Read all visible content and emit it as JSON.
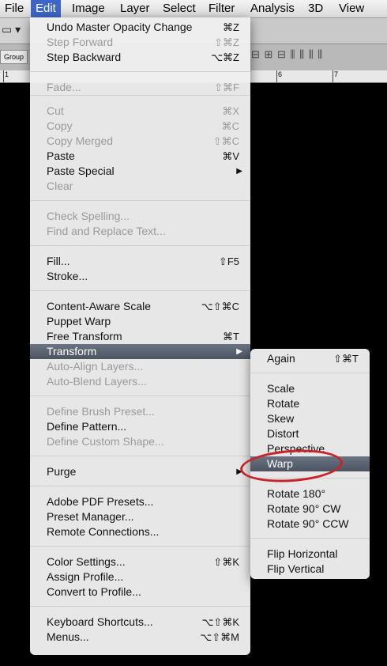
{
  "menubar": [
    "File",
    "Edit",
    "Image",
    "Layer",
    "Select",
    "Filter",
    "Analysis",
    "3D",
    "View"
  ],
  "options": {
    "group_label": "Group"
  },
  "ruler": [
    "1",
    "6",
    "7"
  ],
  "edit_menu": [
    {
      "label": "Undo Master Opacity Change",
      "shortcut": "⌘Z",
      "enabled": true
    },
    {
      "label": "Step Forward",
      "shortcut": "⇧⌘Z",
      "enabled": false
    },
    {
      "label": "Step Backward",
      "shortcut": "⌥⌘Z",
      "enabled": true
    },
    {
      "label": "Fade...",
      "shortcut": "⇧⌘F",
      "enabled": false
    },
    {
      "label": "Cut",
      "shortcut": "⌘X",
      "enabled": false
    },
    {
      "label": "Copy",
      "shortcut": "⌘C",
      "enabled": false
    },
    {
      "label": "Copy Merged",
      "shortcut": "⇧⌘C",
      "enabled": false
    },
    {
      "label": "Paste",
      "shortcut": "⌘V",
      "enabled": true
    },
    {
      "label": "Paste Special",
      "shortcut": "▶",
      "enabled": true
    },
    {
      "label": "Clear",
      "shortcut": "",
      "enabled": false
    },
    {
      "label": "Check Spelling...",
      "shortcut": "",
      "enabled": false
    },
    {
      "label": "Find and Replace Text...",
      "shortcut": "",
      "enabled": false
    },
    {
      "label": "Fill...",
      "shortcut": "⇧F5",
      "enabled": true
    },
    {
      "label": "Stroke...",
      "shortcut": "",
      "enabled": true
    },
    {
      "label": "Content-Aware Scale",
      "shortcut": "⌥⇧⌘C",
      "enabled": true
    },
    {
      "label": "Puppet Warp",
      "shortcut": "",
      "enabled": true
    },
    {
      "label": "Free Transform",
      "shortcut": "⌘T",
      "enabled": true
    },
    {
      "label": "Transform",
      "shortcut": "▶",
      "enabled": true
    },
    {
      "label": "Auto-Align Layers...",
      "shortcut": "",
      "enabled": false
    },
    {
      "label": "Auto-Blend Layers...",
      "shortcut": "",
      "enabled": false
    },
    {
      "label": "Define Brush Preset...",
      "shortcut": "",
      "enabled": false
    },
    {
      "label": "Define Pattern...",
      "shortcut": "",
      "enabled": true
    },
    {
      "label": "Define Custom Shape...",
      "shortcut": "",
      "enabled": false
    },
    {
      "label": "Purge",
      "shortcut": "▶",
      "enabled": true
    },
    {
      "label": "Adobe PDF Presets...",
      "shortcut": "",
      "enabled": true
    },
    {
      "label": "Preset Manager...",
      "shortcut": "",
      "enabled": true
    },
    {
      "label": "Remote Connections...",
      "shortcut": "",
      "enabled": true
    },
    {
      "label": "Color Settings...",
      "shortcut": "⇧⌘K",
      "enabled": true
    },
    {
      "label": "Assign Profile...",
      "shortcut": "",
      "enabled": true
    },
    {
      "label": "Convert to Profile...",
      "shortcut": "",
      "enabled": true
    },
    {
      "label": "Keyboard Shortcuts...",
      "shortcut": "⌥⇧⌘K",
      "enabled": true
    },
    {
      "label": "Menus...",
      "shortcut": "⌥⇧⌘M",
      "enabled": true
    }
  ],
  "transform_menu": [
    {
      "label": "Again",
      "shortcut": "⇧⌘T"
    },
    {
      "label": "Scale",
      "shortcut": ""
    },
    {
      "label": "Rotate",
      "shortcut": ""
    },
    {
      "label": "Skew",
      "shortcut": ""
    },
    {
      "label": "Distort",
      "shortcut": ""
    },
    {
      "label": "Perspective",
      "shortcut": ""
    },
    {
      "label": "Warp",
      "shortcut": ""
    },
    {
      "label": "Rotate 180°",
      "shortcut": ""
    },
    {
      "label": "Rotate 90° CW",
      "shortcut": ""
    },
    {
      "label": "Rotate 90° CCW",
      "shortcut": ""
    },
    {
      "label": "Flip Horizontal",
      "shortcut": ""
    },
    {
      "label": "Flip Vertical",
      "shortcut": ""
    }
  ]
}
